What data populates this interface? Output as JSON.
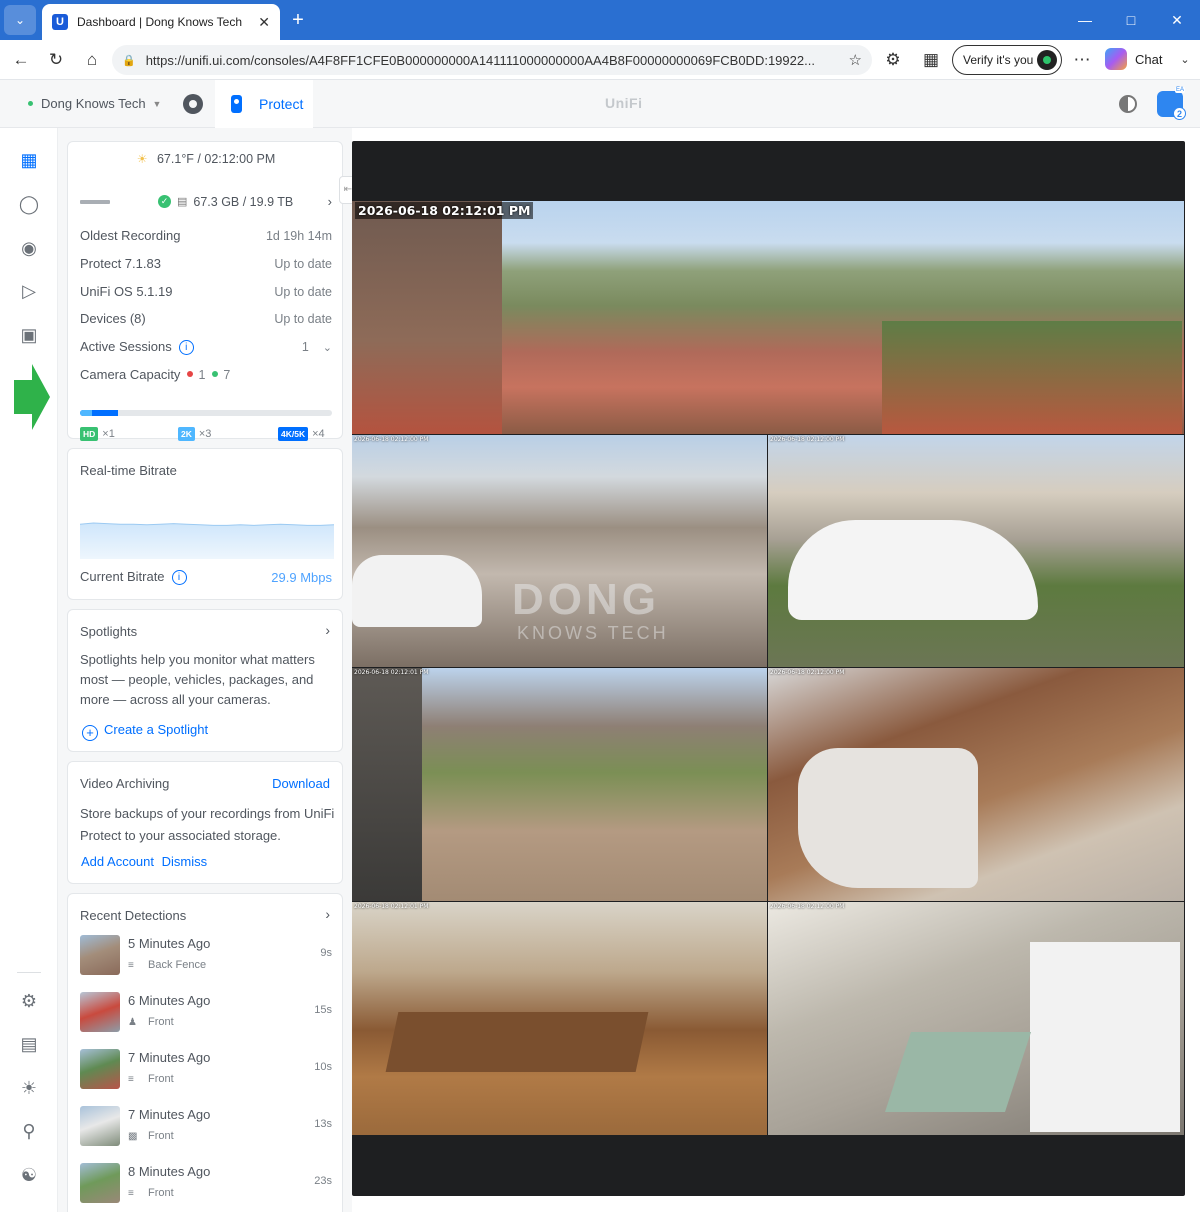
{
  "browser": {
    "tab_title": "Dashboard | Dong Knows Tech",
    "tab_favicon": "U",
    "url": "https://unifi.ui.com/consoles/A4F8FF1CFE0B000000000A141111000000000AA4B8F00000000069FCB0DD:19922...",
    "verify_label": "Verify it's you",
    "chat_label": "Chat"
  },
  "header": {
    "site_name": "Dong Knows Tech",
    "app_tab": "Protect",
    "logo": "UniFi",
    "notif_count": "2",
    "notif_tag": "EA"
  },
  "status": {
    "weather": "67.1°F / 02:12:00 PM",
    "storage": "67.3 GB / 19.9 TB",
    "rows": [
      {
        "label": "Oldest Recording",
        "value": "1d 19h 14m"
      },
      {
        "label": "Protect 7.1.83",
        "value": "Up to date"
      },
      {
        "label": "UniFi OS 5.1.19",
        "value": "Up to date"
      },
      {
        "label": "Devices (8)",
        "value": "Up to date"
      }
    ],
    "active_sessions_label": "Active Sessions",
    "active_sessions_value": "1",
    "camera_capacity_label": "Camera Capacity",
    "capacity_offline": "1",
    "capacity_online": "7",
    "capacity_used_fraction": 0.15,
    "badges": [
      {
        "tag": "HD",
        "count": "×1",
        "color": "#38c172"
      },
      {
        "tag": "2K",
        "count": "×3",
        "color": "#4fb7ff"
      },
      {
        "tag": "4K/5K",
        "count": "×4",
        "color": "#006fff"
      }
    ]
  },
  "bitrate": {
    "title": "Real-time Bitrate",
    "current_label": "Current Bitrate",
    "current_value": "29.9 Mbps",
    "series": [
      60,
      62,
      61,
      60,
      60,
      59,
      60,
      61,
      60,
      59,
      58,
      58,
      59,
      58,
      59,
      60,
      59,
      58,
      58,
      59
    ]
  },
  "spotlights": {
    "title": "Spotlights",
    "description": "Spotlights help you monitor what matters most — people, vehicles, packages, and more — across all your cameras.",
    "action": "Create a Spotlight"
  },
  "archiving": {
    "title": "Video Archiving",
    "download": "Download",
    "description": "Store backups of your recordings from UniFi Protect to your associated storage.",
    "add_account": "Add Account",
    "dismiss": "Dismiss"
  },
  "detections": {
    "title": "Recent Detections",
    "items": [
      {
        "time": "5 Minutes Ago",
        "camera": "Back Fence",
        "duration": "9s",
        "icon": "motion-icon"
      },
      {
        "time": "6 Minutes Ago",
        "camera": "Front",
        "duration": "15s",
        "icon": "person-icon"
      },
      {
        "time": "7 Minutes Ago",
        "camera": "Front",
        "duration": "10s",
        "icon": "motion-icon"
      },
      {
        "time": "7 Minutes Ago",
        "camera": "Front",
        "duration": "13s",
        "icon": "vehicle-icon"
      },
      {
        "time": "8 Minutes Ago",
        "camera": "Front",
        "duration": "23s",
        "icon": "motion-icon"
      }
    ]
  },
  "cameras": {
    "main_timestamp": "2026-06-18  02:12:01 PM",
    "timestamps": [
      "2026-06-18 02:12:00 PM",
      "2026-06-18 02:12:00 PM",
      "2026-06-18 02:12:01 PM",
      "2026-06-18 02:12:00 PM",
      "2026-06-18 02:12:01 PM",
      "2026-06-18 02:12:00 PM"
    ],
    "watermark": "DONG",
    "watermark_sub": "KNOWS TECH"
  }
}
